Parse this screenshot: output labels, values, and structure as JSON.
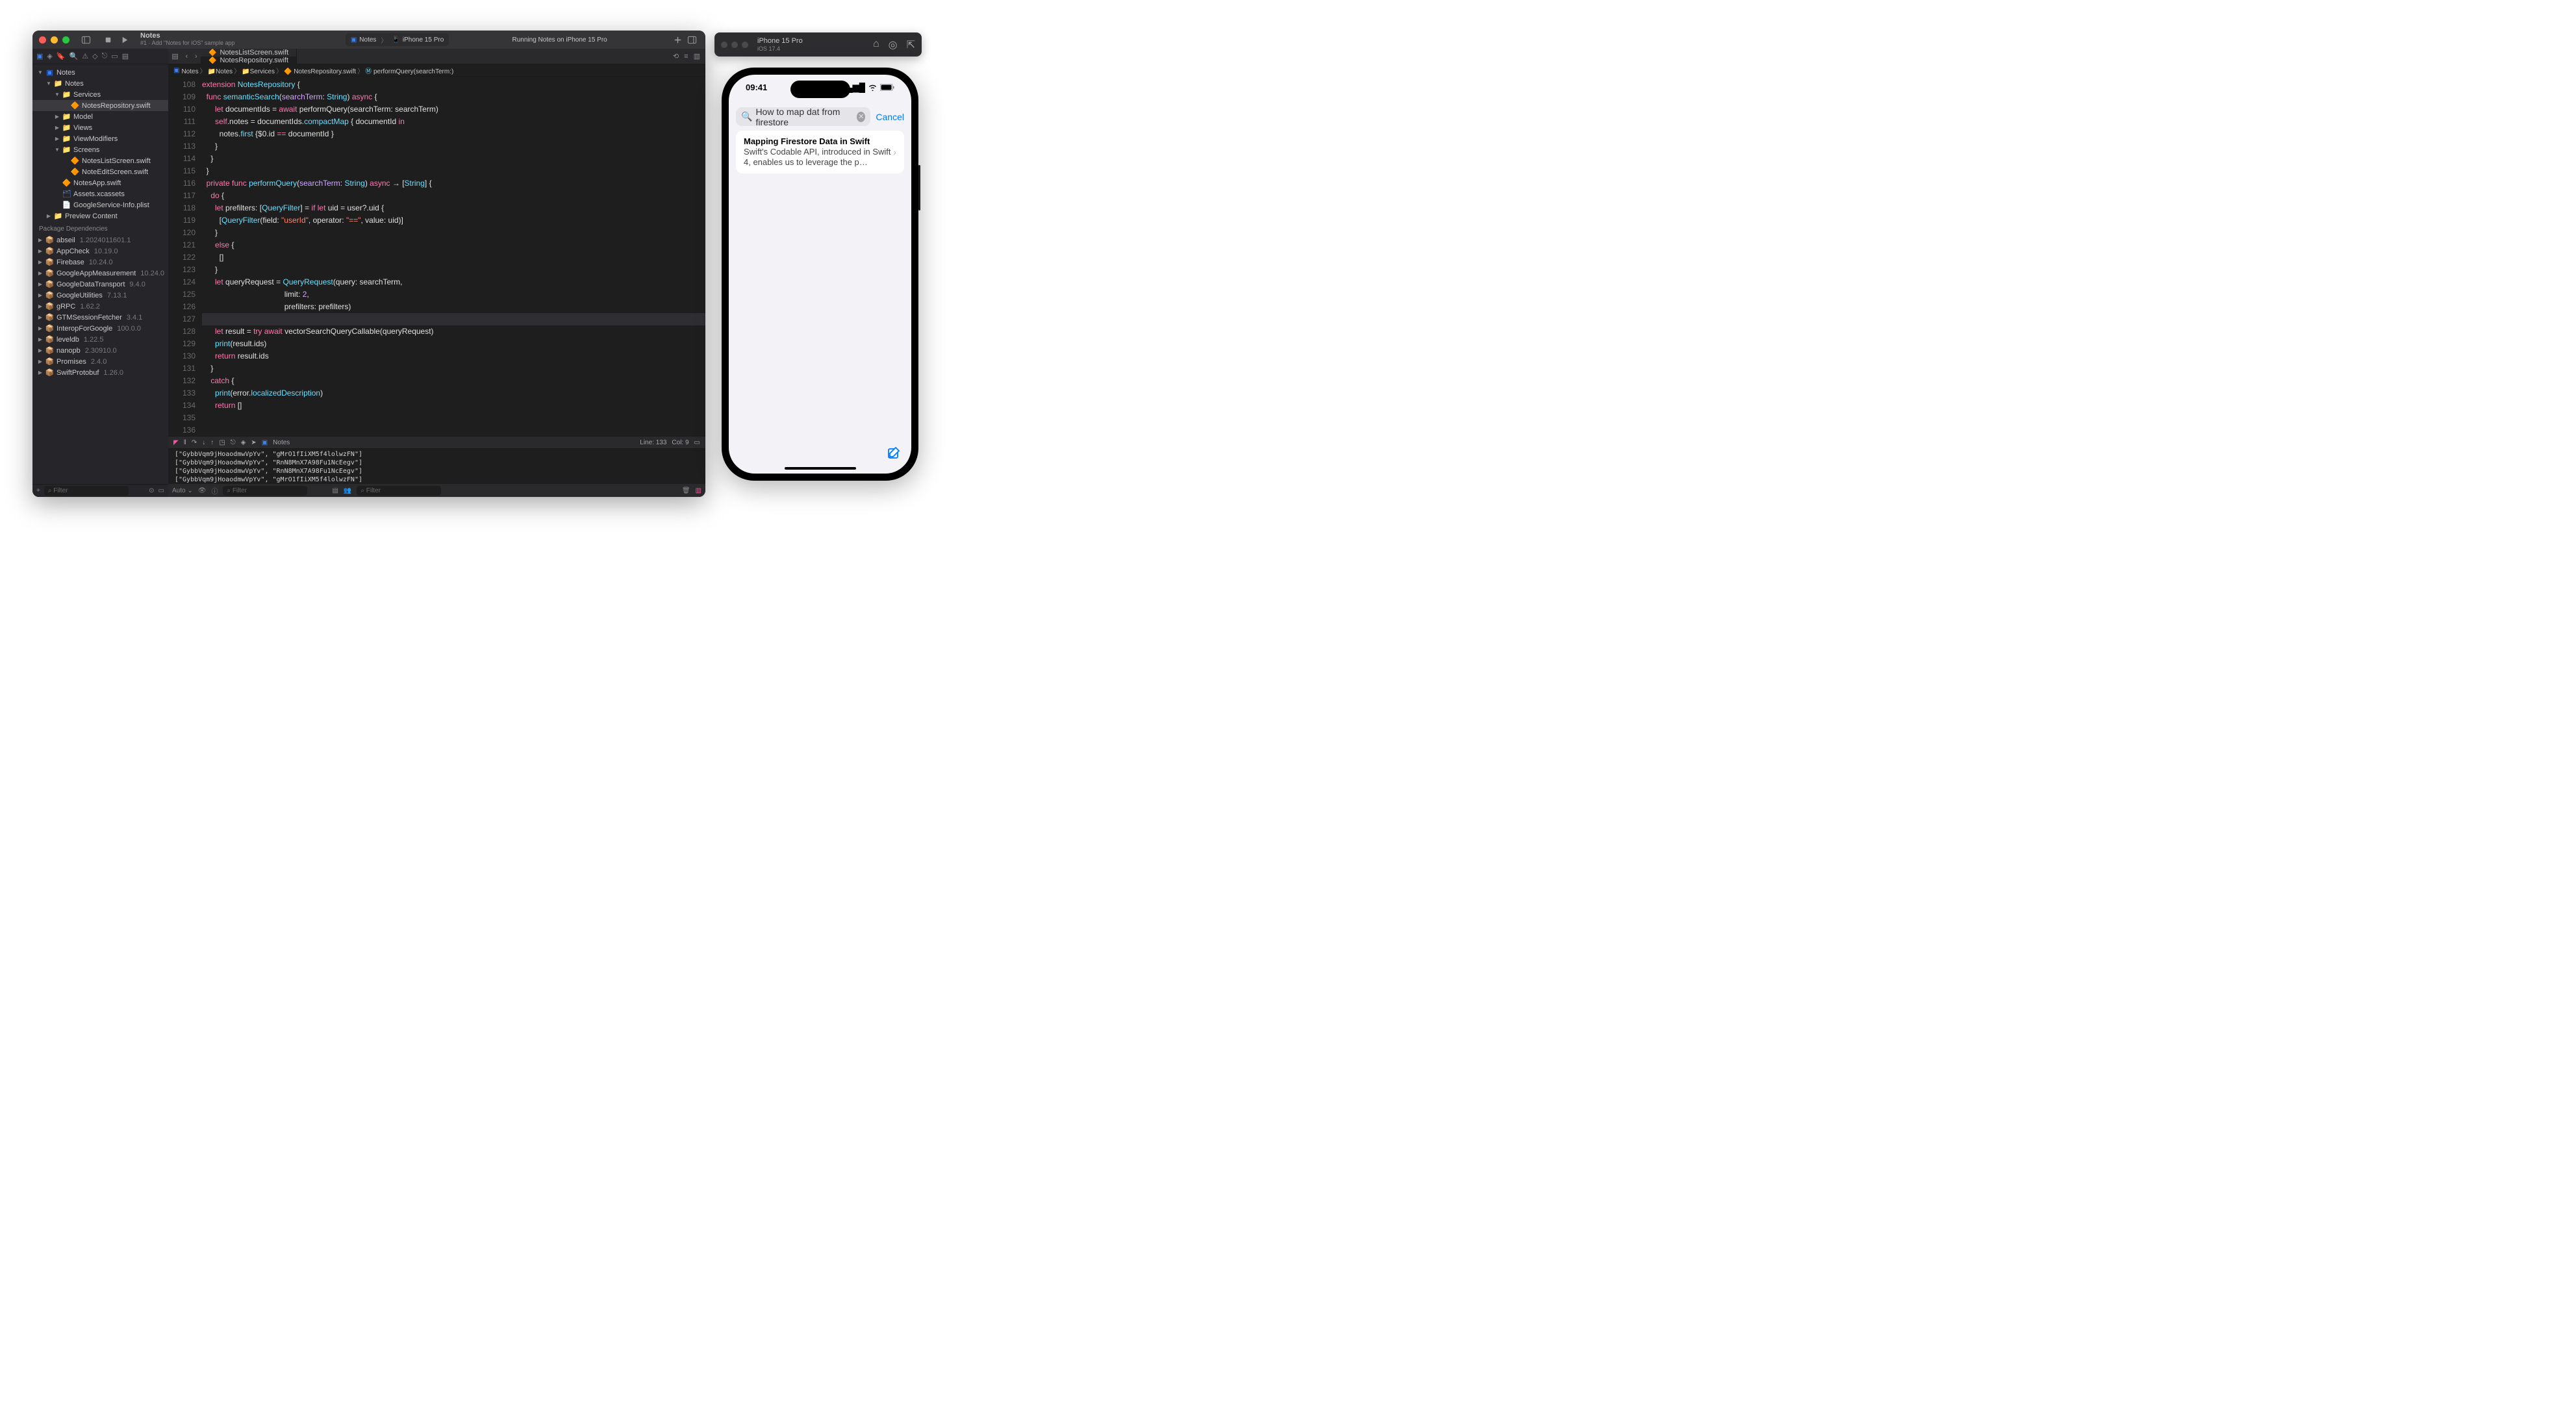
{
  "toolbar": {
    "project": "Notes",
    "subtitle": "#1 · Add \"Notes for iOS\" sample app",
    "scheme": "Notes",
    "destination": "iPhone 15 Pro",
    "runStatus": "Running Notes on iPhone 15 Pro"
  },
  "nav": {
    "tree": [
      {
        "d": 0,
        "exp": true,
        "icon": "app",
        "label": "Notes"
      },
      {
        "d": 1,
        "exp": true,
        "icon": "folder",
        "label": "Notes"
      },
      {
        "d": 2,
        "exp": true,
        "icon": "folder",
        "label": "Services"
      },
      {
        "d": 3,
        "icon": "swift",
        "label": "NotesRepository.swift",
        "sel": true
      },
      {
        "d": 2,
        "exp": false,
        "icon": "folder",
        "label": "Model"
      },
      {
        "d": 2,
        "exp": false,
        "icon": "folder",
        "label": "Views"
      },
      {
        "d": 2,
        "exp": false,
        "icon": "folder",
        "label": "ViewModifiers"
      },
      {
        "d": 2,
        "exp": true,
        "icon": "folder",
        "label": "Screens"
      },
      {
        "d": 3,
        "icon": "swift",
        "label": "NotesListScreen.swift"
      },
      {
        "d": 3,
        "icon": "swift",
        "label": "NoteEditScreen.swift"
      },
      {
        "d": 2,
        "icon": "swift",
        "label": "NotesApp.swift"
      },
      {
        "d": 2,
        "icon": "assets",
        "label": "Assets.xcassets"
      },
      {
        "d": 2,
        "icon": "plist",
        "label": "GoogleService-Info.plist"
      },
      {
        "d": 1,
        "exp": false,
        "icon": "folder",
        "label": "Preview Content"
      }
    ],
    "depsHeader": "Package Dependencies",
    "deps": [
      {
        "name": "abseil",
        "ver": "1.2024011601.1"
      },
      {
        "name": "AppCheck",
        "ver": "10.19.0"
      },
      {
        "name": "Firebase",
        "ver": "10.24.0"
      },
      {
        "name": "GoogleAppMeasurement",
        "ver": "10.24.0"
      },
      {
        "name": "GoogleDataTransport",
        "ver": "9.4.0"
      },
      {
        "name": "GoogleUtilities",
        "ver": "7.13.1"
      },
      {
        "name": "gRPC",
        "ver": "1.62.2"
      },
      {
        "name": "GTMSessionFetcher",
        "ver": "3.4.1"
      },
      {
        "name": "InteropForGoogle",
        "ver": "100.0.0"
      },
      {
        "name": "leveldb",
        "ver": "1.22.5"
      },
      {
        "name": "nanopb",
        "ver": "2.30910.0"
      },
      {
        "name": "Promises",
        "ver": "2.4.0"
      },
      {
        "name": "SwiftProtobuf",
        "ver": "1.26.0"
      }
    ],
    "filter": "Filter"
  },
  "tabs": [
    {
      "label": "NotesListScreen.swift",
      "active": false
    },
    {
      "label": "NotesRepository.swift",
      "active": true
    }
  ],
  "jump": [
    "Notes",
    "Notes",
    "Services",
    "NotesRepository.swift",
    "performQuery(searchTerm:)"
  ],
  "code": {
    "start": 108,
    "lines": [
      {
        "t": [
          [
            "kw",
            "extension"
          ],
          [
            "",
            ""
          ],
          [
            "ty",
            " NotesRepository"
          ],
          [
            "",
            " {"
          ]
        ]
      },
      {
        "t": [
          [
            "",
            "  "
          ],
          [
            "kw",
            "func"
          ],
          [
            "",
            " "
          ],
          [
            "fn",
            "semanticSearch"
          ],
          [
            "",
            "("
          ],
          [
            "lv",
            "searchTerm"
          ],
          [
            "",
            ": "
          ],
          [
            "ty",
            "String"
          ],
          [
            "",
            ") "
          ],
          [
            "kw",
            "async"
          ],
          [
            "",
            " {"
          ]
        ]
      },
      {
        "t": [
          [
            "",
            "      "
          ],
          [
            "kw",
            "let"
          ],
          [
            "",
            " documentIds = "
          ],
          [
            "kw",
            "await"
          ],
          [
            "",
            " performQuery(searchTerm: searchTerm)"
          ]
        ]
      },
      {
        "t": [
          [
            "",
            "      "
          ],
          [
            "kw",
            "self"
          ],
          [
            "",
            ".notes = documentIds."
          ],
          [
            "fn",
            "compactMap"
          ],
          [
            "",
            " { documentId "
          ],
          [
            "kw",
            "in"
          ]
        ]
      },
      {
        "t": [
          [
            "",
            "        notes."
          ],
          [
            "fn",
            "first"
          ],
          [
            "",
            " {$0.id "
          ],
          [
            "kw",
            "=="
          ],
          [
            "",
            " documentId }"
          ]
        ]
      },
      {
        "t": [
          [
            "",
            "      }"
          ]
        ]
      },
      {
        "t": [
          [
            "",
            "    }"
          ]
        ]
      },
      {
        "t": [
          [
            "",
            "  }"
          ]
        ]
      },
      {
        "t": [
          [
            "",
            ""
          ]
        ]
      },
      {
        "t": [
          [
            "",
            "  "
          ],
          [
            "kw",
            "private"
          ],
          [
            "",
            " "
          ],
          [
            "kw",
            "func"
          ],
          [
            "",
            " "
          ],
          [
            "fn",
            "performQuery"
          ],
          [
            "",
            "("
          ],
          [
            "lv",
            "searchTerm"
          ],
          [
            "",
            ": "
          ],
          [
            "ty",
            "String"
          ],
          [
            "",
            ") "
          ],
          [
            "kw",
            "async"
          ],
          [
            "",
            " → ["
          ],
          [
            "ty",
            "String"
          ],
          [
            "",
            "] {"
          ]
        ]
      },
      {
        "t": [
          [
            "",
            "    "
          ],
          [
            "kw",
            "do"
          ],
          [
            "",
            " {"
          ]
        ]
      },
      {
        "t": [
          [
            "",
            "      "
          ],
          [
            "kw",
            "let"
          ],
          [
            "",
            " prefilters: ["
          ],
          [
            "ty",
            "QueryFilter"
          ],
          [
            "",
            "] = "
          ],
          [
            "kw",
            "if"
          ],
          [
            "",
            " "
          ],
          [
            "kw",
            "let"
          ],
          [
            "",
            " uid = user?.uid {"
          ]
        ]
      },
      {
        "t": [
          [
            "",
            "        ["
          ],
          [
            "ty",
            "QueryFilter"
          ],
          [
            "",
            "(field: "
          ],
          [
            "st",
            "\"userId\""
          ],
          [
            "",
            ", operator: "
          ],
          [
            "st",
            "\"==\""
          ],
          [
            "",
            ", value: uid)]"
          ]
        ]
      },
      {
        "t": [
          [
            "",
            "      }"
          ]
        ]
      },
      {
        "t": [
          [
            "",
            "      "
          ],
          [
            "kw",
            "else"
          ],
          [
            "",
            " {"
          ]
        ]
      },
      {
        "t": [
          [
            "",
            "        []"
          ]
        ]
      },
      {
        "t": [
          [
            "",
            "      }"
          ]
        ]
      },
      {
        "t": [
          [
            "",
            ""
          ]
        ]
      },
      {
        "t": [
          [
            "",
            "      "
          ],
          [
            "kw",
            "let"
          ],
          [
            "",
            " queryRequest = "
          ],
          [
            "ty",
            "QueryRequest"
          ],
          [
            "",
            "(query: searchTerm,"
          ]
        ]
      },
      {
        "t": [
          [
            "",
            "                                      limit: "
          ],
          [
            "lv",
            "2"
          ],
          [
            "",
            ","
          ]
        ]
      },
      {
        "t": [
          [
            "",
            "                                      prefilters: prefilters)"
          ]
        ]
      },
      {
        "hl": true,
        "t": [
          [
            "",
            "      "
          ]
        ]
      },
      {
        "t": [
          [
            "",
            "      "
          ],
          [
            "kw",
            "let"
          ],
          [
            "",
            " result = "
          ],
          [
            "kw",
            "try"
          ],
          [
            "",
            " "
          ],
          [
            "kw",
            "await"
          ],
          [
            "",
            " vectorSearchQueryCallable(queryRequest)"
          ]
        ]
      },
      {
        "t": [
          [
            "",
            "      "
          ],
          [
            "fn",
            "print"
          ],
          [
            "",
            "(result.ids)"
          ]
        ]
      },
      {
        "t": [
          [
            "",
            "      "
          ],
          [
            "kw",
            "return"
          ],
          [
            "",
            " result.ids"
          ]
        ]
      },
      {
        "t": [
          [
            "",
            "    }"
          ]
        ]
      },
      {
        "t": [
          [
            "",
            "    "
          ],
          [
            "kw",
            "catch"
          ],
          [
            "",
            " {"
          ]
        ]
      },
      {
        "t": [
          [
            "",
            "      "
          ],
          [
            "fn",
            "print"
          ],
          [
            "",
            "(error."
          ],
          [
            "fn",
            "localizedDescription"
          ],
          [
            "",
            ")"
          ]
        ]
      },
      {
        "t": [
          [
            "",
            "      "
          ],
          [
            "kw",
            "return"
          ],
          [
            "",
            " []"
          ]
        ]
      }
    ]
  },
  "status": {
    "scope": "Notes",
    "line": "Line: 133",
    "col": "Col: 9"
  },
  "console": [
    "[\"GybbVqm9jHoaodmwVpYv\", \"gMrO1fIiXM5f4lolwzFN\"]",
    "[\"GybbVqm9jHoaodmwVpYv\", \"RnN8MnX7A98Fu1NcEegv\"]",
    "[\"GybbVqm9jHoaodmwVpYv\", \"RnN8MnX7A98Fu1NcEegv\"]",
    "[\"GybbVqm9jHoaodmwVpYv\", \"gMrO1fIiXM5f4lolwzFN\"]"
  ],
  "bottomBar": {
    "auto": "Auto ⌄",
    "filter": "Filter"
  },
  "sim": {
    "title": "iPhone 15 Pro",
    "subtitle": "iOS 17.4"
  },
  "phone": {
    "time": "09:41",
    "search": "How to map dat from firestore",
    "cancel": "Cancel",
    "card": {
      "title": "Mapping Firestore Data in Swift",
      "sub": "Swift's Codable API, introduced in Swift 4, enables us to leverage the p…"
    }
  }
}
